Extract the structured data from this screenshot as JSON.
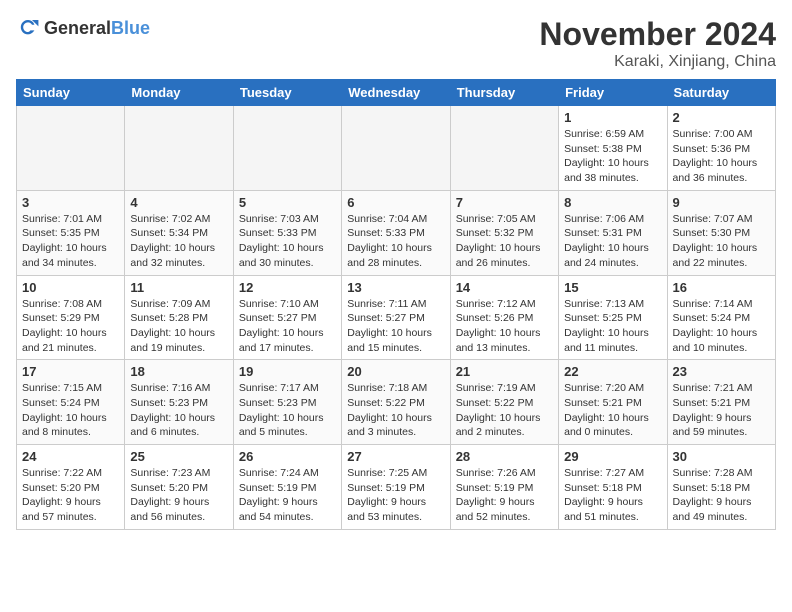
{
  "header": {
    "logo_general": "General",
    "logo_blue": "Blue",
    "title": "November 2024",
    "subtitle": "Karaki, Xinjiang, China"
  },
  "weekdays": [
    "Sunday",
    "Monday",
    "Tuesday",
    "Wednesday",
    "Thursday",
    "Friday",
    "Saturday"
  ],
  "weeks": [
    [
      {
        "day": "",
        "info": ""
      },
      {
        "day": "",
        "info": ""
      },
      {
        "day": "",
        "info": ""
      },
      {
        "day": "",
        "info": ""
      },
      {
        "day": "",
        "info": ""
      },
      {
        "day": "1",
        "info": "Sunrise: 6:59 AM\nSunset: 5:38 PM\nDaylight: 10 hours and 38 minutes."
      },
      {
        "day": "2",
        "info": "Sunrise: 7:00 AM\nSunset: 5:36 PM\nDaylight: 10 hours and 36 minutes."
      }
    ],
    [
      {
        "day": "3",
        "info": "Sunrise: 7:01 AM\nSunset: 5:35 PM\nDaylight: 10 hours and 34 minutes."
      },
      {
        "day": "4",
        "info": "Sunrise: 7:02 AM\nSunset: 5:34 PM\nDaylight: 10 hours and 32 minutes."
      },
      {
        "day": "5",
        "info": "Sunrise: 7:03 AM\nSunset: 5:33 PM\nDaylight: 10 hours and 30 minutes."
      },
      {
        "day": "6",
        "info": "Sunrise: 7:04 AM\nSunset: 5:33 PM\nDaylight: 10 hours and 28 minutes."
      },
      {
        "day": "7",
        "info": "Sunrise: 7:05 AM\nSunset: 5:32 PM\nDaylight: 10 hours and 26 minutes."
      },
      {
        "day": "8",
        "info": "Sunrise: 7:06 AM\nSunset: 5:31 PM\nDaylight: 10 hours and 24 minutes."
      },
      {
        "day": "9",
        "info": "Sunrise: 7:07 AM\nSunset: 5:30 PM\nDaylight: 10 hours and 22 minutes."
      }
    ],
    [
      {
        "day": "10",
        "info": "Sunrise: 7:08 AM\nSunset: 5:29 PM\nDaylight: 10 hours and 21 minutes."
      },
      {
        "day": "11",
        "info": "Sunrise: 7:09 AM\nSunset: 5:28 PM\nDaylight: 10 hours and 19 minutes."
      },
      {
        "day": "12",
        "info": "Sunrise: 7:10 AM\nSunset: 5:27 PM\nDaylight: 10 hours and 17 minutes."
      },
      {
        "day": "13",
        "info": "Sunrise: 7:11 AM\nSunset: 5:27 PM\nDaylight: 10 hours and 15 minutes."
      },
      {
        "day": "14",
        "info": "Sunrise: 7:12 AM\nSunset: 5:26 PM\nDaylight: 10 hours and 13 minutes."
      },
      {
        "day": "15",
        "info": "Sunrise: 7:13 AM\nSunset: 5:25 PM\nDaylight: 10 hours and 11 minutes."
      },
      {
        "day": "16",
        "info": "Sunrise: 7:14 AM\nSunset: 5:24 PM\nDaylight: 10 hours and 10 minutes."
      }
    ],
    [
      {
        "day": "17",
        "info": "Sunrise: 7:15 AM\nSunset: 5:24 PM\nDaylight: 10 hours and 8 minutes."
      },
      {
        "day": "18",
        "info": "Sunrise: 7:16 AM\nSunset: 5:23 PM\nDaylight: 10 hours and 6 minutes."
      },
      {
        "day": "19",
        "info": "Sunrise: 7:17 AM\nSunset: 5:23 PM\nDaylight: 10 hours and 5 minutes."
      },
      {
        "day": "20",
        "info": "Sunrise: 7:18 AM\nSunset: 5:22 PM\nDaylight: 10 hours and 3 minutes."
      },
      {
        "day": "21",
        "info": "Sunrise: 7:19 AM\nSunset: 5:22 PM\nDaylight: 10 hours and 2 minutes."
      },
      {
        "day": "22",
        "info": "Sunrise: 7:20 AM\nSunset: 5:21 PM\nDaylight: 10 hours and 0 minutes."
      },
      {
        "day": "23",
        "info": "Sunrise: 7:21 AM\nSunset: 5:21 PM\nDaylight: 9 hours and 59 minutes."
      }
    ],
    [
      {
        "day": "24",
        "info": "Sunrise: 7:22 AM\nSunset: 5:20 PM\nDaylight: 9 hours and 57 minutes."
      },
      {
        "day": "25",
        "info": "Sunrise: 7:23 AM\nSunset: 5:20 PM\nDaylight: 9 hours and 56 minutes."
      },
      {
        "day": "26",
        "info": "Sunrise: 7:24 AM\nSunset: 5:19 PM\nDaylight: 9 hours and 54 minutes."
      },
      {
        "day": "27",
        "info": "Sunrise: 7:25 AM\nSunset: 5:19 PM\nDaylight: 9 hours and 53 minutes."
      },
      {
        "day": "28",
        "info": "Sunrise: 7:26 AM\nSunset: 5:19 PM\nDaylight: 9 hours and 52 minutes."
      },
      {
        "day": "29",
        "info": "Sunrise: 7:27 AM\nSunset: 5:18 PM\nDaylight: 9 hours and 51 minutes."
      },
      {
        "day": "30",
        "info": "Sunrise: 7:28 AM\nSunset: 5:18 PM\nDaylight: 9 hours and 49 minutes."
      }
    ]
  ]
}
